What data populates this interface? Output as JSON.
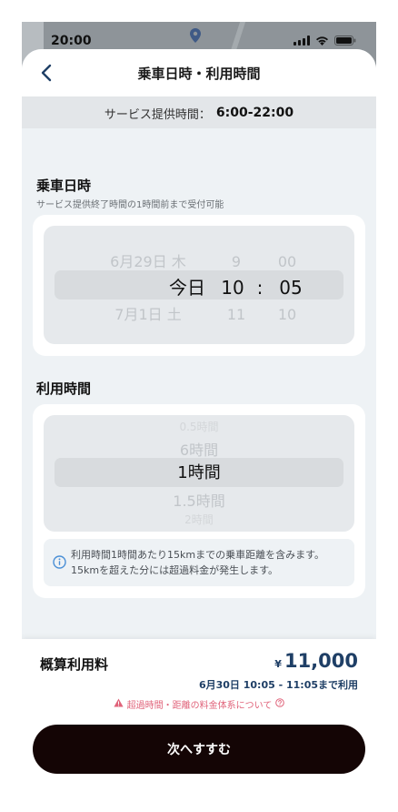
{
  "status_bar": {
    "time": "20:00"
  },
  "header": {
    "title": "乗車日時・利用時間",
    "back_icon": "chevron-left-icon"
  },
  "service_hours": {
    "label": "サービス提供時間：",
    "value": "6:00-22:00"
  },
  "ride_datetime": {
    "title": "乗車日時",
    "subtitle": "サービス提供終了時間の1時間前まで受付可能",
    "above": {
      "date": "6月29日 木",
      "hour": "9",
      "minute": "00"
    },
    "selected": {
      "date": "今日",
      "hour": "10",
      "separator": ":",
      "minute": "05"
    },
    "below": {
      "date": "7月1日 土",
      "hour": "11",
      "minute": "10"
    }
  },
  "usage_time": {
    "title": "利用時間",
    "options_above": [
      "0.5時間",
      "6時間"
    ],
    "selected": "1時間",
    "options_below": [
      "1.5時間",
      "2時間"
    ],
    "notice_line1": "利用時間1時間あたり15kmまでの乗車距離を含みます。",
    "notice_line2": "15kmを超えた分には超過料金が発生します。"
  },
  "estimate": {
    "label": "概算利用料",
    "currency": "¥",
    "price": "11,000",
    "period": "6月30日 10:05 - 11:05まで利用",
    "link": "超過時間・距離の料金体系について"
  },
  "next_button": {
    "label": "次へすすむ"
  },
  "colors": {
    "accent": "#1f3f66",
    "button": "#140505",
    "warning": "#e0637a"
  }
}
